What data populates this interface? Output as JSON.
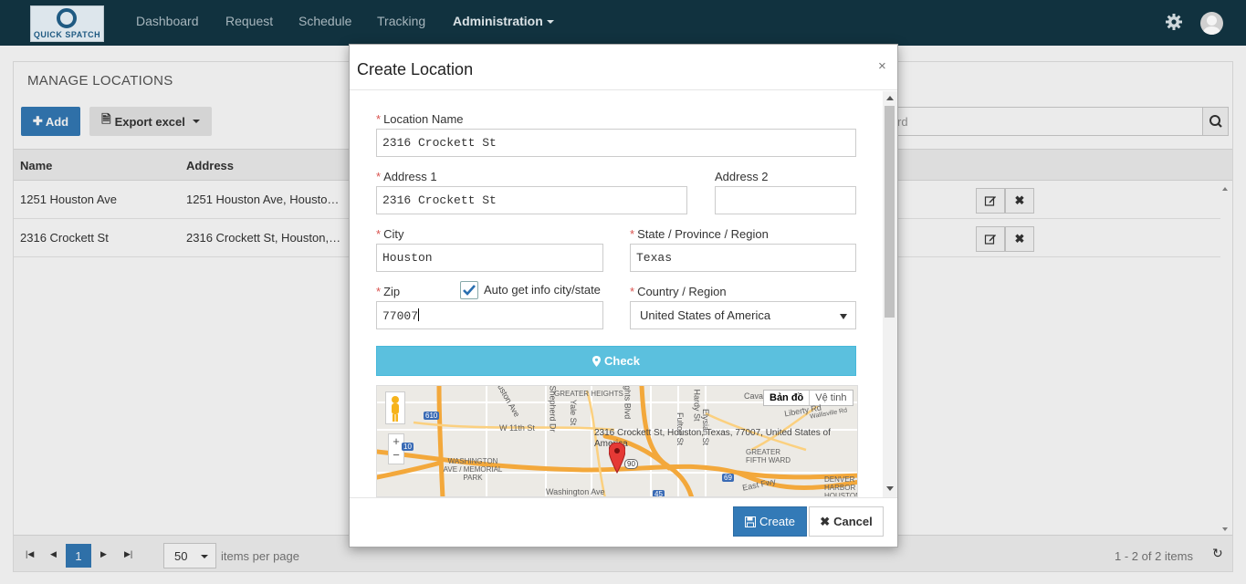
{
  "nav": {
    "logo_text": "QUICK SPATCH",
    "items": [
      "Dashboard",
      "Request",
      "Schedule",
      "Tracking"
    ],
    "active": "Administration"
  },
  "page": {
    "title": "MANAGE LOCATIONS",
    "add_label": "Add",
    "export_label": "Export excel",
    "search_placeholder": "rd",
    "columns": [
      "Name",
      "Address"
    ],
    "rows": [
      {
        "name": "1251 Houston Ave",
        "address": "1251 Houston Ave, Housto…"
      },
      {
        "name": "2316 Crockett St",
        "address": "2316 Crockett St, Houston,…"
      }
    ],
    "pager": {
      "current_page": "1",
      "page_size": "50",
      "page_size_label": "items per page",
      "summary": "1 - 2 of 2 items"
    }
  },
  "modal": {
    "title": "Create Location",
    "close_symbol": "×",
    "required_mark": "*",
    "location_name": {
      "label": "Location Name",
      "value": "2316 Crockett St"
    },
    "address1": {
      "label": "Address 1",
      "value": "2316 Crockett St"
    },
    "address2": {
      "label": "Address 2",
      "value": ""
    },
    "city": {
      "label": "City",
      "value": "Houston"
    },
    "state": {
      "label": "State / Province / Region",
      "value": "Texas"
    },
    "zip": {
      "label": "Zip",
      "value": "77007"
    },
    "auto_get": {
      "label": "Auto get info city/state",
      "checked": true
    },
    "country": {
      "label": "Country / Region",
      "value": "United States of America"
    },
    "check_label": "Check",
    "map": {
      "type_options": [
        "Bản đồ",
        "Vệ tinh"
      ],
      "active_type": "Bản đồ",
      "address_label": "2316 Crockett St, Houston, Texas, 77007, United States of America",
      "place_labels": [
        "GREATER HEIGHTS",
        "W 11th St",
        "WASHINGTON AVE / MEMORIAL PARK",
        "Washington Ave",
        "GREATER FIFTH WARD",
        "East Fwy",
        "DENVER HARBOR / HOUSTON",
        "Cava",
        "Liberty Rd",
        "Wallisville Rd",
        "Shepherd Dr",
        "Yale St",
        "Hardy St",
        "Elysian St",
        "Fulton St",
        "Heights Blvd",
        "Houston Ave"
      ],
      "highway_labels": [
        "610",
        "10",
        "90",
        "69",
        "45"
      ]
    },
    "create_label": "Create",
    "cancel_label": "Cancel"
  },
  "colors": {
    "navbar": "#11323f",
    "primary": "#337ab7",
    "info": "#5bc0de",
    "danger": "#d9534f"
  }
}
